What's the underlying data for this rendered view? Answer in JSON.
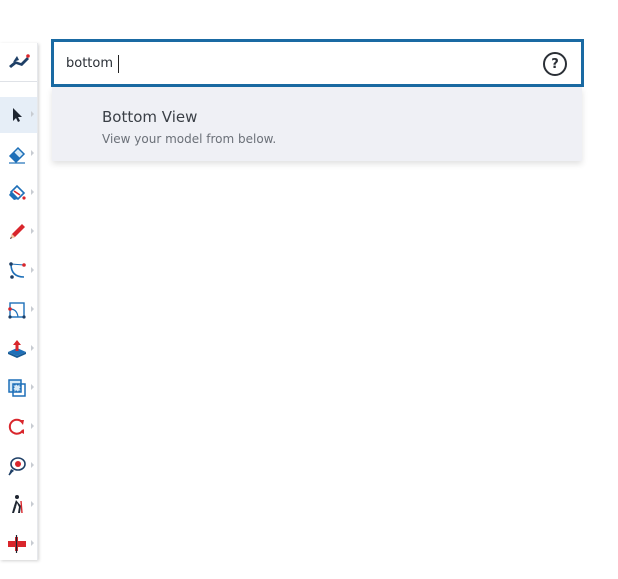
{
  "search": {
    "value": "bottom",
    "help_label": "?"
  },
  "results": [
    {
      "title": "Bottom View",
      "description": "View your model from below."
    }
  ],
  "toolbar": {
    "logo_icon": "sketchup-logo-icon",
    "tools": [
      {
        "name": "select-tool",
        "icon": "arrow-cursor-icon",
        "active": true
      },
      {
        "name": "eraser-tool",
        "icon": "eraser-icon"
      },
      {
        "name": "paint-bucket-tool",
        "icon": "paint-bucket-icon"
      },
      {
        "name": "pencil-tool",
        "icon": "pencil-icon"
      },
      {
        "name": "arc-tool",
        "icon": "arc-icon"
      },
      {
        "name": "rectangle-tool",
        "icon": "rectangle-icon"
      },
      {
        "name": "push-pull-tool",
        "icon": "push-pull-icon"
      },
      {
        "name": "offset-tool",
        "icon": "offset-icon"
      },
      {
        "name": "rotate-tool",
        "icon": "rotate-icon"
      },
      {
        "name": "position-camera-tool",
        "icon": "position-camera-icon"
      },
      {
        "name": "walk-tool",
        "icon": "walk-icon"
      },
      {
        "name": "section-plane-tool",
        "icon": "section-plane-icon"
      }
    ]
  },
  "colors": {
    "accent": "#1a6aa3",
    "tool_red": "#d9262c",
    "tool_blue": "#1d6fb8",
    "result_bg": "#eff0f5"
  }
}
